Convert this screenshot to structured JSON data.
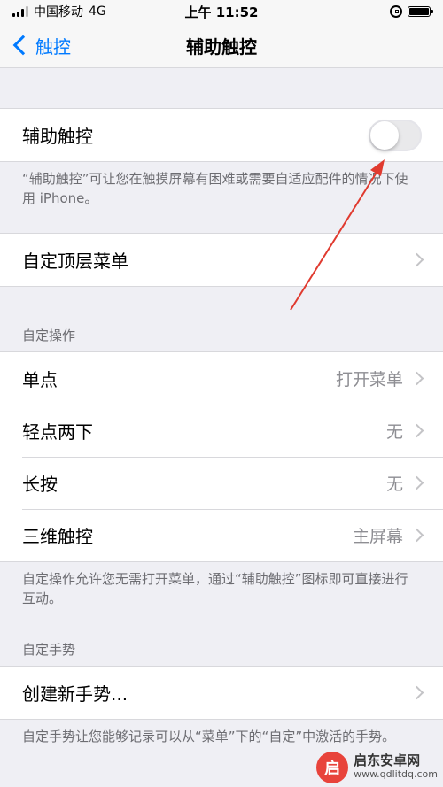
{
  "status": {
    "carrier": "中国移动",
    "network": "4G",
    "time": "上午 11:52"
  },
  "nav": {
    "back_label": "触控",
    "title": "辅助触控"
  },
  "toggle_row": {
    "label": "辅助触控",
    "enabled": false
  },
  "toggle_note": "“辅助触控”可让您在触摸屏幕有困难或需要自适应配件的情况下使用 iPhone。",
  "top_menu_row": {
    "label": "自定顶层菜单"
  },
  "custom_actions": {
    "header": "自定操作",
    "items": [
      {
        "label": "单点",
        "value": "打开菜单"
      },
      {
        "label": "轻点两下",
        "value": "无"
      },
      {
        "label": "长按",
        "value": "无"
      },
      {
        "label": "三维触控",
        "value": "主屏幕"
      }
    ],
    "footer": "自定操作允许您无需打开菜单，通过“辅助触控”图标即可直接进行互动。"
  },
  "custom_gestures": {
    "header": "自定手势",
    "create_label": "创建新手势...",
    "footer": "自定手势让您能够记录可以从“菜单”下的“自定”中激活的手势。"
  },
  "watermark": {
    "title": "启东安卓网",
    "url": "www.qdlitdq.com",
    "logo_char": "启"
  },
  "colors": {
    "accent": "#007aff",
    "arrow": "#e03a2f",
    "background": "#efeff4"
  }
}
